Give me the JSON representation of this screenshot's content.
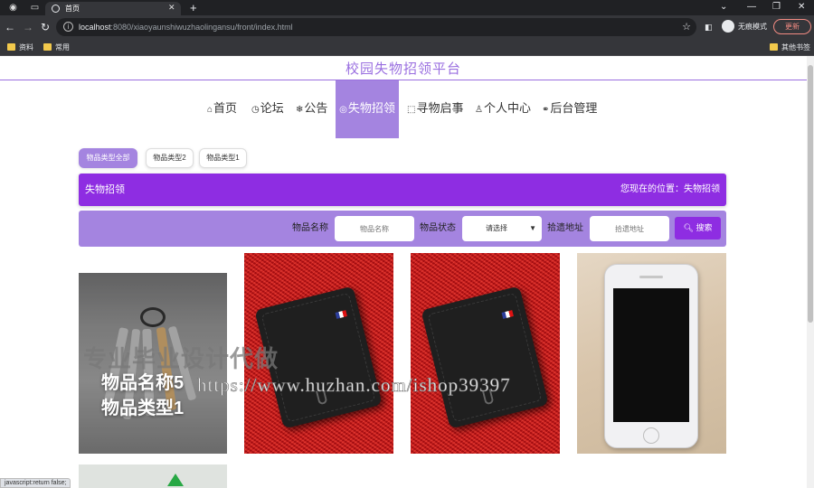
{
  "browser": {
    "tab_title": "首页",
    "url_host": "localhost",
    "url_rest": ":8080/xiaoyaunshiwuzhaolingansu/front/index.html",
    "incognito_label": "无痕模式",
    "update_label": "更新",
    "bookmarks": [
      "资料",
      "常用"
    ],
    "other_bookmarks": "其他书签",
    "status_text": "javascript:return false;"
  },
  "site": {
    "title": "校园失物招领平台",
    "nav": [
      {
        "icon": "⌂",
        "label": "首页"
      },
      {
        "icon": "◷",
        "label": "论坛"
      },
      {
        "icon": "❄",
        "label": "公告"
      },
      {
        "icon": "◎",
        "label": "失物招领"
      },
      {
        "icon": "⬚",
        "label": "寻物启事"
      },
      {
        "icon": "♙",
        "label": "个人中心"
      },
      {
        "icon": "⚭",
        "label": "后台管理"
      }
    ],
    "active_nav": "失物招领"
  },
  "filters": [
    "物品类型全部",
    "物品类型2",
    "物品类型1"
  ],
  "breadcrumb": {
    "left": "失物招领",
    "right": "您现在的位置：失物招领"
  },
  "search": {
    "name_label": "物品名称",
    "name_placeholder": "物品名称",
    "status_label": "物品状态",
    "status_value": "请选择",
    "address_label": "拾遗地址",
    "address_placeholder": "拾遗地址",
    "button_label": "搜索"
  },
  "cards": [
    {
      "name": "物品名称5",
      "type": "物品类型1"
    }
  ],
  "watermark": {
    "line1": "专业毕业设计代做",
    "line2": "https://www.huzhan.com/ishop39397"
  },
  "colors": {
    "brand_purple": "#8e2de2",
    "light_purple": "#a484e0"
  }
}
